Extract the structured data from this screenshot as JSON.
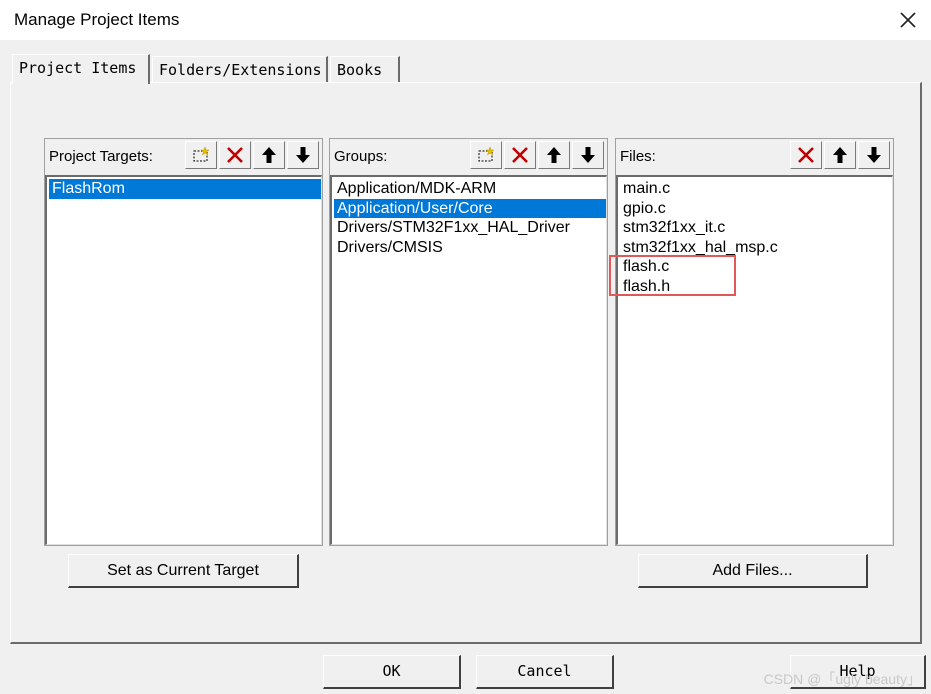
{
  "window": {
    "title": "Manage Project Items"
  },
  "tabs": [
    {
      "label": "Project Items",
      "active": true
    },
    {
      "label": "Folders/Extensions",
      "active": false
    },
    {
      "label": "Books",
      "active": false
    }
  ],
  "targets": {
    "label": "Project Targets:",
    "items": [
      {
        "text": "FlashRom",
        "selected": true
      }
    ]
  },
  "groups": {
    "label": "Groups:",
    "items": [
      {
        "text": "Application/MDK-ARM",
        "selected": false
      },
      {
        "text": "Application/User/Core",
        "selected": true
      },
      {
        "text": "Drivers/STM32F1xx_HAL_Driver",
        "selected": false
      },
      {
        "text": "Drivers/CMSIS",
        "selected": false
      }
    ]
  },
  "files": {
    "label": "Files:",
    "items": [
      {
        "text": "main.c"
      },
      {
        "text": "gpio.c"
      },
      {
        "text": "stm32f1xx_it.c"
      },
      {
        "text": "stm32f1xx_hal_msp.c"
      },
      {
        "text": "flash.c"
      },
      {
        "text": "flash.h"
      }
    ]
  },
  "buttons": {
    "set_current_target": "Set as Current Target",
    "add_files": "Add Files...",
    "ok": "OK",
    "cancel": "Cancel",
    "help": "Help"
  },
  "watermark": "CSDN @「ugly beauty」",
  "colors": {
    "selection": "#0078d7",
    "delete_icon": "#c00000",
    "new_icon": "#e8c000",
    "annotation_box": "#e25757"
  },
  "icons": [
    "new-item-icon",
    "delete-icon",
    "move-up-icon",
    "move-down-icon",
    "close-icon"
  ]
}
